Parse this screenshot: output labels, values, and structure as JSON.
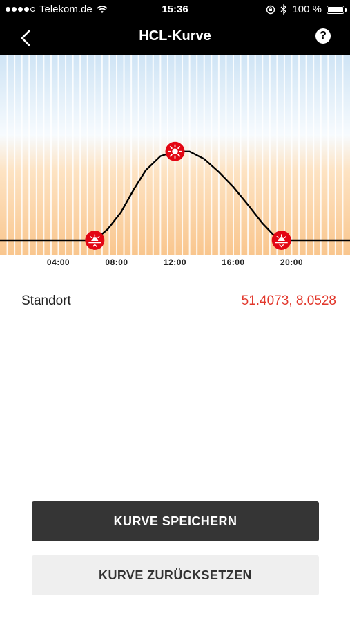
{
  "status_bar": {
    "carrier": "Telekom.de",
    "time": "15:36",
    "battery": "100 %",
    "battery_level": 1.0,
    "icons": [
      "signal-dots-icon",
      "wifi-icon",
      "rotation-lock-icon",
      "bluetooth-icon",
      "battery-icon"
    ]
  },
  "nav": {
    "title": "HCL-Kurve",
    "back_icon": "chevron-left-icon",
    "help_label": "?"
  },
  "chart_data": {
    "type": "line",
    "x_range": [
      0,
      24
    ],
    "x_ticks": [
      "04:00",
      "08:00",
      "12:00",
      "16:00",
      "20:00"
    ],
    "x_tick_values": [
      4,
      8,
      12,
      16,
      20
    ],
    "points": [
      [
        0,
        0
      ],
      [
        6.5,
        0
      ],
      [
        7.4,
        0.12
      ],
      [
        8.3,
        0.3
      ],
      [
        9.2,
        0.55
      ],
      [
        10.0,
        0.75
      ],
      [
        11.0,
        0.9
      ],
      [
        12.0,
        0.95
      ],
      [
        13.0,
        0.95
      ],
      [
        14.0,
        0.87
      ],
      [
        15.0,
        0.73
      ],
      [
        16.0,
        0.57
      ],
      [
        17.0,
        0.38
      ],
      [
        18.0,
        0.18
      ],
      [
        18.8,
        0.05
      ],
      [
        19.3,
        0
      ],
      [
        24,
        0
      ]
    ],
    "markers": [
      {
        "name": "sunrise",
        "icon": "sunrise-icon",
        "x": 6.5,
        "y": 0
      },
      {
        "name": "noon",
        "icon": "sun-icon",
        "x": 12.0,
        "y": 0.95
      },
      {
        "name": "sunset",
        "icon": "sunset-icon",
        "x": 19.3,
        "y": 0
      }
    ],
    "colors": {
      "line": "#000000",
      "marker": "#e30613"
    }
  },
  "location": {
    "label": "Standort",
    "value": "51.4073, 8.0528"
  },
  "buttons": {
    "save": "KURVE SPEICHERN",
    "reset": "KURVE ZURÜCKSETZEN"
  },
  "colors": {
    "accent": "#e2372b",
    "header_bg": "#000000",
    "primary_button": "#353535",
    "secondary_button": "#efefef"
  }
}
